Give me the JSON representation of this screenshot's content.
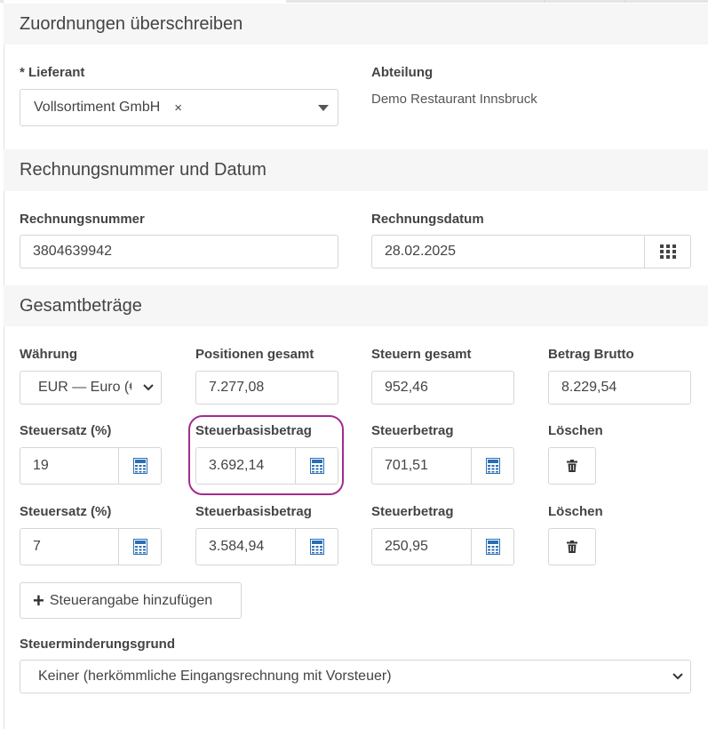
{
  "sections": {
    "assignments": "Zuordnungen überschreiben",
    "invoice": "Rechnungsnummer und Datum",
    "totals": "Gesamtbeträge"
  },
  "supplier": {
    "label": "* Lieferant",
    "value": "Vollsortiment GmbH",
    "clear": "×"
  },
  "department": {
    "label": "Abteilung",
    "value": "Demo Restaurant Innsbruck"
  },
  "invoice": {
    "number_label": "Rechnungsnummer",
    "number_value": "3804639942",
    "date_label": "Rechnungsdatum",
    "date_value": "28.02.2025"
  },
  "totals": {
    "currency_label": "Währung",
    "currency_value": "EUR — Euro (€",
    "positions_label": "Positionen gesamt",
    "positions_value": "7.277,08",
    "taxes_label": "Steuern gesamt",
    "taxes_value": "952,46",
    "gross_label": "Betrag Brutto",
    "gross_value": "8.229,54"
  },
  "tax_rows": [
    {
      "rate_label": "Steuersatz (%)",
      "rate_value": "19",
      "base_label": "Steuerbasisbetrag",
      "base_value": "3.692,14",
      "amount_label": "Steuerbetrag",
      "amount_value": "701,51",
      "delete_label": "Löschen"
    },
    {
      "rate_label": "Steuersatz (%)",
      "rate_value": "7",
      "base_label": "Steuerbasisbetrag",
      "base_value": "3.584,94",
      "amount_label": "Steuerbetrag",
      "amount_value": "250,95",
      "delete_label": "Löschen"
    }
  ],
  "add_tax": {
    "label": "Steuerangabe hinzufügen"
  },
  "reduction": {
    "label": "Steuerminderungsgrund",
    "value": "Keiner (herkömmliche Eingangsrechnung mit Vorsteuer)"
  },
  "colors": {
    "highlight": "#a52a8e",
    "calc_icon": "#2a6fb5"
  },
  "icons": {
    "calculator": "calculator-icon",
    "calendar": "calendar-grid-icon",
    "trash": "trash-icon"
  }
}
